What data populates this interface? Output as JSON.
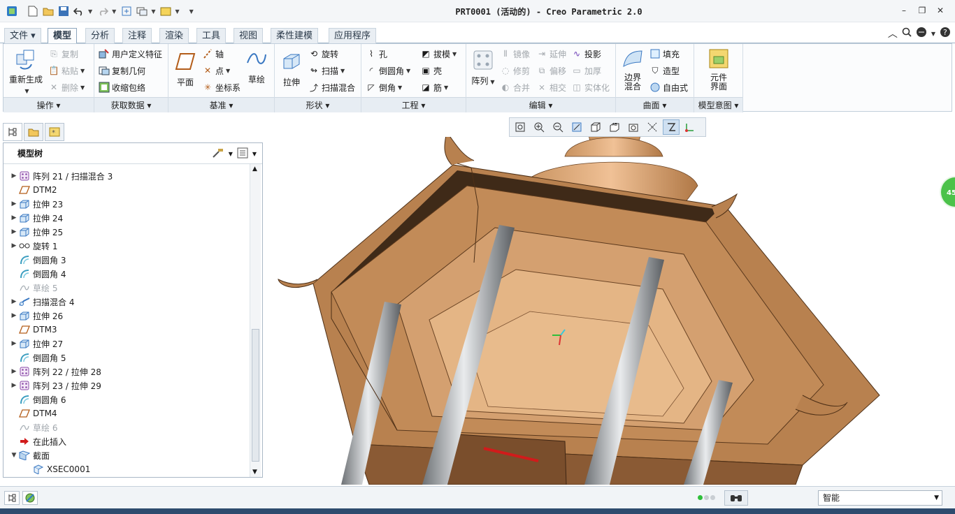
{
  "window": {
    "title": "PRT0001 (活动的) - Creo Parametric 2.0",
    "controls": [
      "–",
      "❐",
      "✕"
    ]
  },
  "ribbon_tabs": [
    {
      "label": "文件 ▾",
      "active": false
    },
    {
      "label": "模型",
      "active": true
    },
    {
      "label": "分析",
      "active": false
    },
    {
      "label": "注释",
      "active": false
    },
    {
      "label": "渲染",
      "active": false
    },
    {
      "label": "工具",
      "active": false
    },
    {
      "label": "视图",
      "active": false
    },
    {
      "label": "柔性建模",
      "active": false
    },
    {
      "label": "应用程序",
      "active": false
    }
  ],
  "ribbon": {
    "operations": {
      "regenerate": "重新生成",
      "copy": "复制",
      "paste": "粘贴",
      "delete": "删除",
      "group_label": "操作"
    },
    "get_data": {
      "user_feature": "用户定义特征",
      "copy_geometry": "复制几何",
      "shrinkwrap": "收缩包络",
      "group_label": "获取数据"
    },
    "datum": {
      "plane": "平面",
      "axis": "轴",
      "point": "点",
      "csys": "坐标系",
      "sketch": "草绘",
      "group_label": "基准"
    },
    "shapes": {
      "extrude": "拉伸",
      "revolve": "旋转",
      "sweep": "扫描",
      "swept_blend": "扫描混合",
      "group_label": "形状"
    },
    "engineering": {
      "hole": "孔",
      "draft": "拔模",
      "round": "倒圆角",
      "shell": "壳",
      "chamfer": "倒角",
      "rib": "筋",
      "group_label": "工程"
    },
    "editing": {
      "pattern": "阵列",
      "mirror": "镜像",
      "extend": "延伸",
      "project": "投影",
      "trim": "修剪",
      "offset": "偏移",
      "thicken": "加厚",
      "merge": "合并",
      "intersect": "相交",
      "solidify": "实体化",
      "group_label": "编辑"
    },
    "surfaces": {
      "boundary_blend": "边界混合",
      "fill": "填充",
      "style": "造型",
      "freestyle": "自由式",
      "group_label": "曲面"
    },
    "model_intent": {
      "component_interface": "元件界面",
      "group_label": "模型意图"
    }
  },
  "model_tree": {
    "title": "模型树",
    "items": [
      {
        "label": "阵列 21 / 扫描混合 3",
        "icon": "pattern-icon",
        "expand": true,
        "disabled": false
      },
      {
        "label": "DTM2",
        "icon": "datum-plane-icon",
        "expand": false,
        "disabled": false
      },
      {
        "label": "拉伸 23",
        "icon": "extrude-icon",
        "expand": true,
        "disabled": false
      },
      {
        "label": "拉伸 24",
        "icon": "extrude-icon",
        "expand": true,
        "disabled": false
      },
      {
        "label": "拉伸 25",
        "icon": "extrude-icon",
        "expand": true,
        "disabled": false
      },
      {
        "label": "旋转 1",
        "icon": "revolve-icon",
        "expand": true,
        "disabled": false
      },
      {
        "label": "倒圆角 3",
        "icon": "round-icon",
        "expand": false,
        "disabled": false
      },
      {
        "label": "倒圆角 4",
        "icon": "round-icon",
        "expand": false,
        "disabled": false
      },
      {
        "label": "草绘 5",
        "icon": "sketch-icon",
        "expand": false,
        "disabled": true
      },
      {
        "label": "扫描混合 4",
        "icon": "swept-blend-icon",
        "expand": true,
        "disabled": false
      },
      {
        "label": "拉伸 26",
        "icon": "extrude-icon",
        "expand": true,
        "disabled": false
      },
      {
        "label": "DTM3",
        "icon": "datum-plane-icon",
        "expand": false,
        "disabled": false
      },
      {
        "label": "拉伸 27",
        "icon": "extrude-icon",
        "expand": true,
        "disabled": false
      },
      {
        "label": "倒圆角 5",
        "icon": "round-icon",
        "expand": false,
        "disabled": false
      },
      {
        "label": "阵列 22 / 拉伸 28",
        "icon": "pattern-icon",
        "expand": true,
        "disabled": false
      },
      {
        "label": "阵列 23 / 拉伸 29",
        "icon": "pattern-icon",
        "expand": true,
        "disabled": false
      },
      {
        "label": "倒圆角 6",
        "icon": "round-icon",
        "expand": false,
        "disabled": false
      },
      {
        "label": "DTM4",
        "icon": "datum-plane-icon",
        "expand": false,
        "disabled": false
      },
      {
        "label": "草绘 6",
        "icon": "sketch-icon",
        "expand": false,
        "disabled": true
      },
      {
        "label": "在此插入",
        "icon": "insert-here-icon",
        "expand": false,
        "disabled": false
      },
      {
        "label": "截面",
        "icon": "section-folder-icon",
        "expand": "open",
        "disabled": false
      },
      {
        "label": "XSEC0001",
        "icon": "xsec-icon",
        "expand": false,
        "disabled": false,
        "indent": true
      }
    ]
  },
  "status": {
    "badge": "45",
    "filter_value": "智能"
  },
  "colors": {
    "accent": "#3a78c2",
    "model_body": "#c8925f",
    "model_light": "#e8b688",
    "model_dark": "#8a5a34",
    "pillar": "#9a9ea3"
  }
}
